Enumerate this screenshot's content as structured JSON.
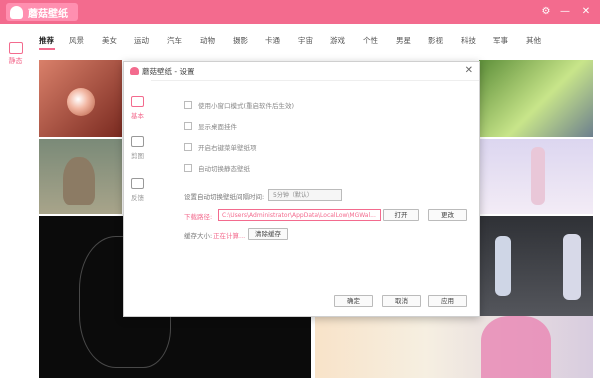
{
  "app": {
    "name": "蘑菇壁纸",
    "settings_icon": "gear-icon",
    "minimize": "—",
    "close": "✕"
  },
  "sidebar": {
    "items": [
      {
        "label": "静态",
        "icon": "image-icon"
      }
    ]
  },
  "tabs": [
    "推荐",
    "风景",
    "美女",
    "运动",
    "汽车",
    "动物",
    "摄影",
    "卡通",
    "宇宙",
    "游戏",
    "个性",
    "男星",
    "影视",
    "科技",
    "军事",
    "其他"
  ],
  "active_tab": "推荐",
  "dialog": {
    "title": "蘑菇壁纸 - 设置",
    "close": "✕",
    "nav": [
      {
        "label": "基本",
        "icon": "layers-icon"
      },
      {
        "label": "剪图",
        "icon": "crop-icon"
      },
      {
        "label": "反馈",
        "icon": "edit-icon"
      }
    ],
    "options": [
      "使用小窗口模式(重启软件后生效)",
      "显示桌面挂件",
      "开启右键菜单壁纸项",
      "自动切换静态壁纸"
    ],
    "interval_label": "设置自动切换壁纸间隔时间:",
    "interval_value": "5分钟（默认）",
    "download_label": "下载路径:",
    "download_path": "C:\\Users\\Administrator\\AppData\\LocalLow\\MGWal...",
    "open_button": "打开",
    "change_button": "更改",
    "cache_label": "缓存大小:",
    "cache_status": "正在计算...",
    "clear_cache_button": "清除缓存",
    "ok_button": "确定",
    "cancel_button": "取消",
    "apply_button": "应用"
  },
  "colors": {
    "accent": "#f36b8e"
  }
}
